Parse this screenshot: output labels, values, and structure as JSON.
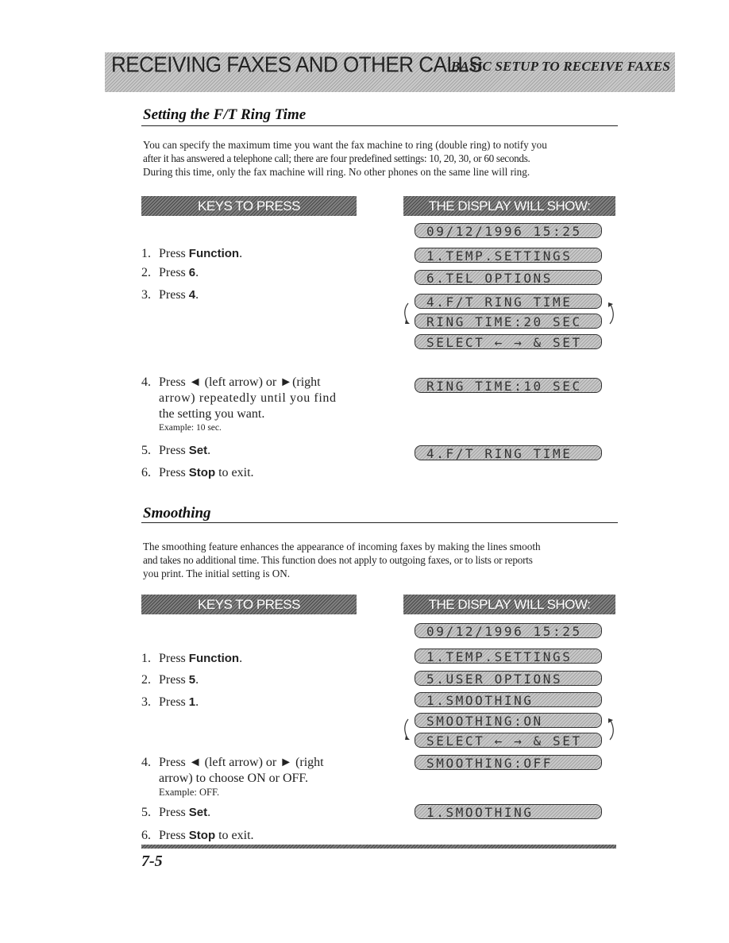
{
  "header": {
    "chapter_title": "RECEIVING FAXES AND OTHER CALLS",
    "section_title": "BASIC SETUP TO RECEIVE FAXES"
  },
  "sections": [
    {
      "title": "Setting the F/T Ring Time",
      "intro_lines": [
        "You can specify the maximum time you want the fax machine to ring (double ring) to notify you",
        "after it has answered a telephone call; there are four predefined settings: 10, 20, 30, or 60 seconds.",
        "During this time, only the fax machine will ring. No other phones on the same line will ring."
      ],
      "keys_header": "KEYS TO PRESS",
      "display_header": "THE DISPLAY WILL SHOW:",
      "steps": [
        {
          "num": "1.",
          "pre": "Press ",
          "key": "Function",
          "post": "."
        },
        {
          "num": "2.",
          "pre": "Press ",
          "key": "6",
          "post": "."
        },
        {
          "num": "3.",
          "pre": "Press ",
          "key": "4",
          "post": "."
        },
        {
          "num": "4.",
          "line1": "Press ◄ (left arrow) or ►(right",
          "line2": "arrow) repeatedly until you find",
          "line3": "the setting you want.",
          "example": "Example: 10 sec."
        },
        {
          "num": "5.",
          "pre": "Press ",
          "key": "Set",
          "post": "."
        },
        {
          "num": "6.",
          "pre": "Press ",
          "key": "Stop",
          "post": " to exit."
        }
      ],
      "displays": [
        "09/12/1996 15:25",
        "1.TEMP.SETTINGS",
        "6.TEL OPTIONS",
        "4.F/T RING TIME",
        "RING TIME:20 SEC",
        "SELECT ← → & SET",
        "RING TIME:10 SEC",
        "4.F/T RING TIME"
      ]
    },
    {
      "title": "Smoothing",
      "intro_lines": [
        "The smoothing feature enhances the appearance of incoming faxes by making the lines smooth",
        "and takes no additional time. This function does not apply to outgoing faxes, or to lists or reports",
        "you print. The initial setting is ON."
      ],
      "keys_header": "KEYS TO PRESS",
      "display_header": "THE DISPLAY WILL SHOW:",
      "steps": [
        {
          "num": "1.",
          "pre": "Press ",
          "key": "Function",
          "post": "."
        },
        {
          "num": "2.",
          "pre": "Press ",
          "key": "5",
          "post": "."
        },
        {
          "num": "3.",
          "pre": "Press ",
          "key": "1",
          "post": "."
        },
        {
          "num": "4.",
          "line1": "Press ◄ (left arrow) or ► (right",
          "line2": "arrow) to choose ON or OFF.",
          "example": "Example: OFF."
        },
        {
          "num": "5.",
          "pre": "Press ",
          "key": "Set",
          "post": "."
        },
        {
          "num": "6.",
          "pre": "Press ",
          "key": "Stop",
          "post": " to exit."
        }
      ],
      "displays": [
        "09/12/1996 15:25",
        "1.TEMP.SETTINGS",
        "5.USER OPTIONS",
        "1.SMOOTHING",
        "SMOOTHING:ON",
        "SELECT ← → & SET",
        "SMOOTHING:OFF",
        "1.SMOOTHING"
      ]
    }
  ],
  "footer": {
    "page_number": "7-5"
  }
}
